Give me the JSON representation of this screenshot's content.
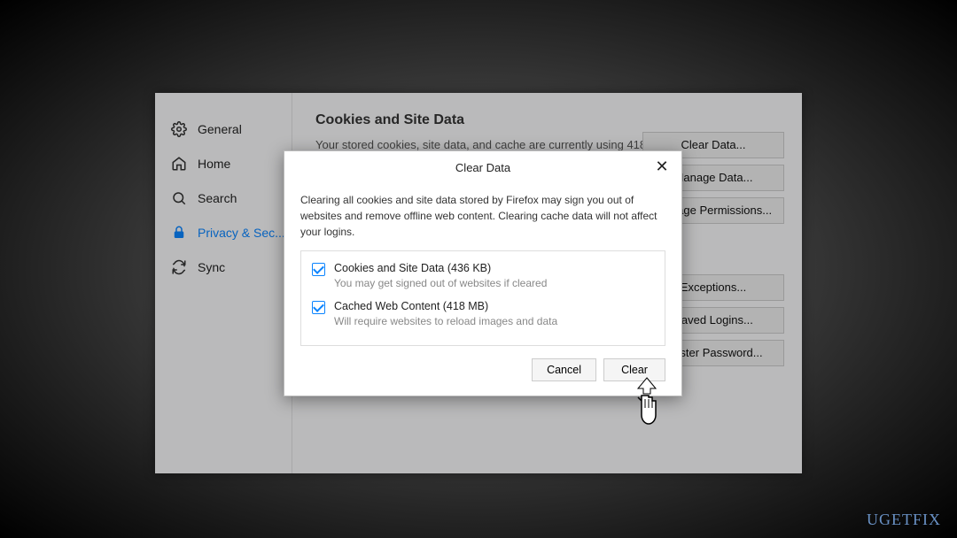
{
  "sidebar": {
    "items": [
      {
        "label": "General"
      },
      {
        "label": "Home"
      },
      {
        "label": "Search"
      },
      {
        "label": "Privacy & Sec..."
      },
      {
        "label": "Sync"
      }
    ]
  },
  "content": {
    "section_title": "Cookies and Site Data",
    "section_desc": "Your stored cookies, site data, and cache are currently using 418",
    "buttons": {
      "clear_data": "Clear Data...",
      "manage_data": "Manage Data...",
      "manage_permissions": "Manage Permissions...",
      "exceptions": "Exceptions...",
      "saved_logins": "Saved Logins...",
      "master_password": "Master Password..."
    }
  },
  "dialog": {
    "title": "Clear Data",
    "close": "✕",
    "text": "Clearing all cookies and site data stored by Firefox may sign you out of websites and remove offline web content. Clearing cache data will not affect your logins.",
    "opt1_label": "Cookies and Site Data (436 KB)",
    "opt1_sub": "You may get signed out of websites if cleared",
    "opt2_label": "Cached Web Content (418 MB)",
    "opt2_sub": "Will require websites to reload images and data",
    "cancel": "Cancel",
    "clear": "Clear"
  },
  "watermark": "UGETFIX"
}
